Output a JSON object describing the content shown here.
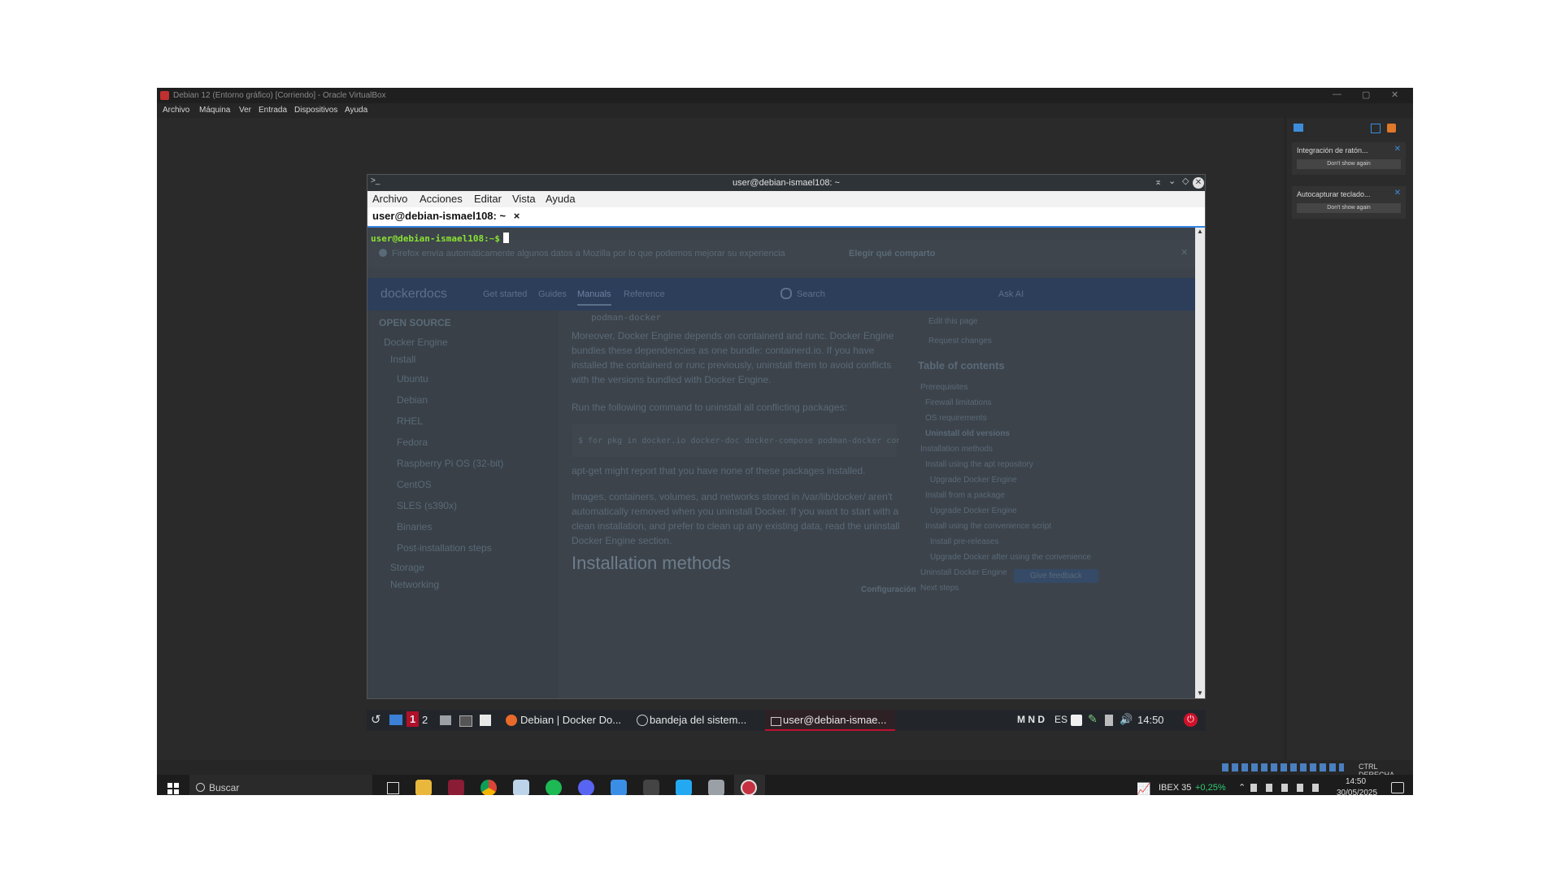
{
  "vbox": {
    "title": "Debian 12 (Entorno gráfico) [Corriendo] - Oracle VirtualBox",
    "menu": [
      "Archivo",
      "Máquina",
      "Ver",
      "Entrada",
      "Dispositivos",
      "Ayuda"
    ],
    "controls": [
      "—",
      "▢",
      "✕"
    ]
  },
  "terminal": {
    "title": "user@debian-ismael108: ~",
    "menu": [
      "Archivo",
      "Acciones",
      "Editar",
      "Vista",
      "Ayuda"
    ],
    "tab_label": "user@debian-ismael108: ~",
    "tab_close": "×",
    "prompt": "user@debian-ismael108:~$"
  },
  "background_page": {
    "notice": "Firefox envía automáticamente algunos datos a Mozilla por lo que podemos mejorar su experiencia",
    "notice_action": "Elegir qué comparto",
    "brand": "dockerdocs",
    "nav": [
      "Get started",
      "Guides",
      "Manuals",
      "Reference"
    ],
    "search": "Search",
    "ask": "Ask AI",
    "sidebar_heading": "OPEN SOURCE",
    "sidebar": [
      "Docker Engine",
      "Install",
      "Ubuntu",
      "Debian",
      "RHEL",
      "Fedora",
      "Raspberry Pi OS (32-bit)",
      "CentOS",
      "SLES (s390x)",
      "Binaries",
      "Post-installation steps",
      "Storage",
      "Networking"
    ],
    "code_top": "podman-docker",
    "para1": "Moreover, Docker Engine depends on containerd and runc. Docker Engine bundles these dependencies as one bundle: containerd.io. If you have installed the containerd or runc previously, uninstall them to avoid conflicts with the versions bundled with Docker Engine.",
    "para2": "Run the following command to uninstall all conflicting packages:",
    "code": "$ for pkg in docker.io docker-doc docker-compose podman-docker containe",
    "para3": "apt-get might report that you have none of these packages installed.",
    "para4": "Images, containers, volumes, and networks stored in /var/lib/docker/ aren't automatically removed when you uninstall Docker. If you want to start with a clean installation, and prefer to clean up any existing data, read the uninstall Docker Engine section.",
    "heading": "Installation methods",
    "edit": "Edit this page",
    "request": "Request changes",
    "toc_title": "Table of contents",
    "toc": [
      "Prerequisites",
      "Firewall limitations",
      "OS requirements",
      "Uninstall old versions",
      "Installation methods",
      "Install using the apt repository",
      "Upgrade Docker Engine",
      "Install from a package",
      "Upgrade Docker Engine",
      "Install using the convenience script",
      "Install pre-releases",
      "Upgrade Docker after using the convenience",
      "Uninstall Docker Engine",
      "Next steps"
    ],
    "feedback": "Give feedback",
    "config": "Configuración"
  },
  "guest_taskbar": {
    "ws1": "1",
    "ws2": "2",
    "task1": "Debian | Docker Do...",
    "task2": "bandeja del sistem...",
    "task3": "user@debian-ismae...",
    "indicators": "M N D",
    "lang": "ES",
    "time": "14:50"
  },
  "notifications": [
    {
      "title": "Integración de ratón...",
      "button": "Don't show again"
    },
    {
      "title": "Autocapturar teclado...",
      "button": "Don't show again"
    }
  ],
  "vbox_status": {
    "hostkey": "CTRL DERECHA"
  },
  "windows_taskbar": {
    "search": "Buscar",
    "ticker": "IBEX 35",
    "ticker_change": "+0,25%",
    "time": "14:50",
    "date": "30/05/2025"
  },
  "colors": {
    "prompt": "#8ae234",
    "accent": "#3584e4",
    "ticker_up": "#2ecc71"
  }
}
